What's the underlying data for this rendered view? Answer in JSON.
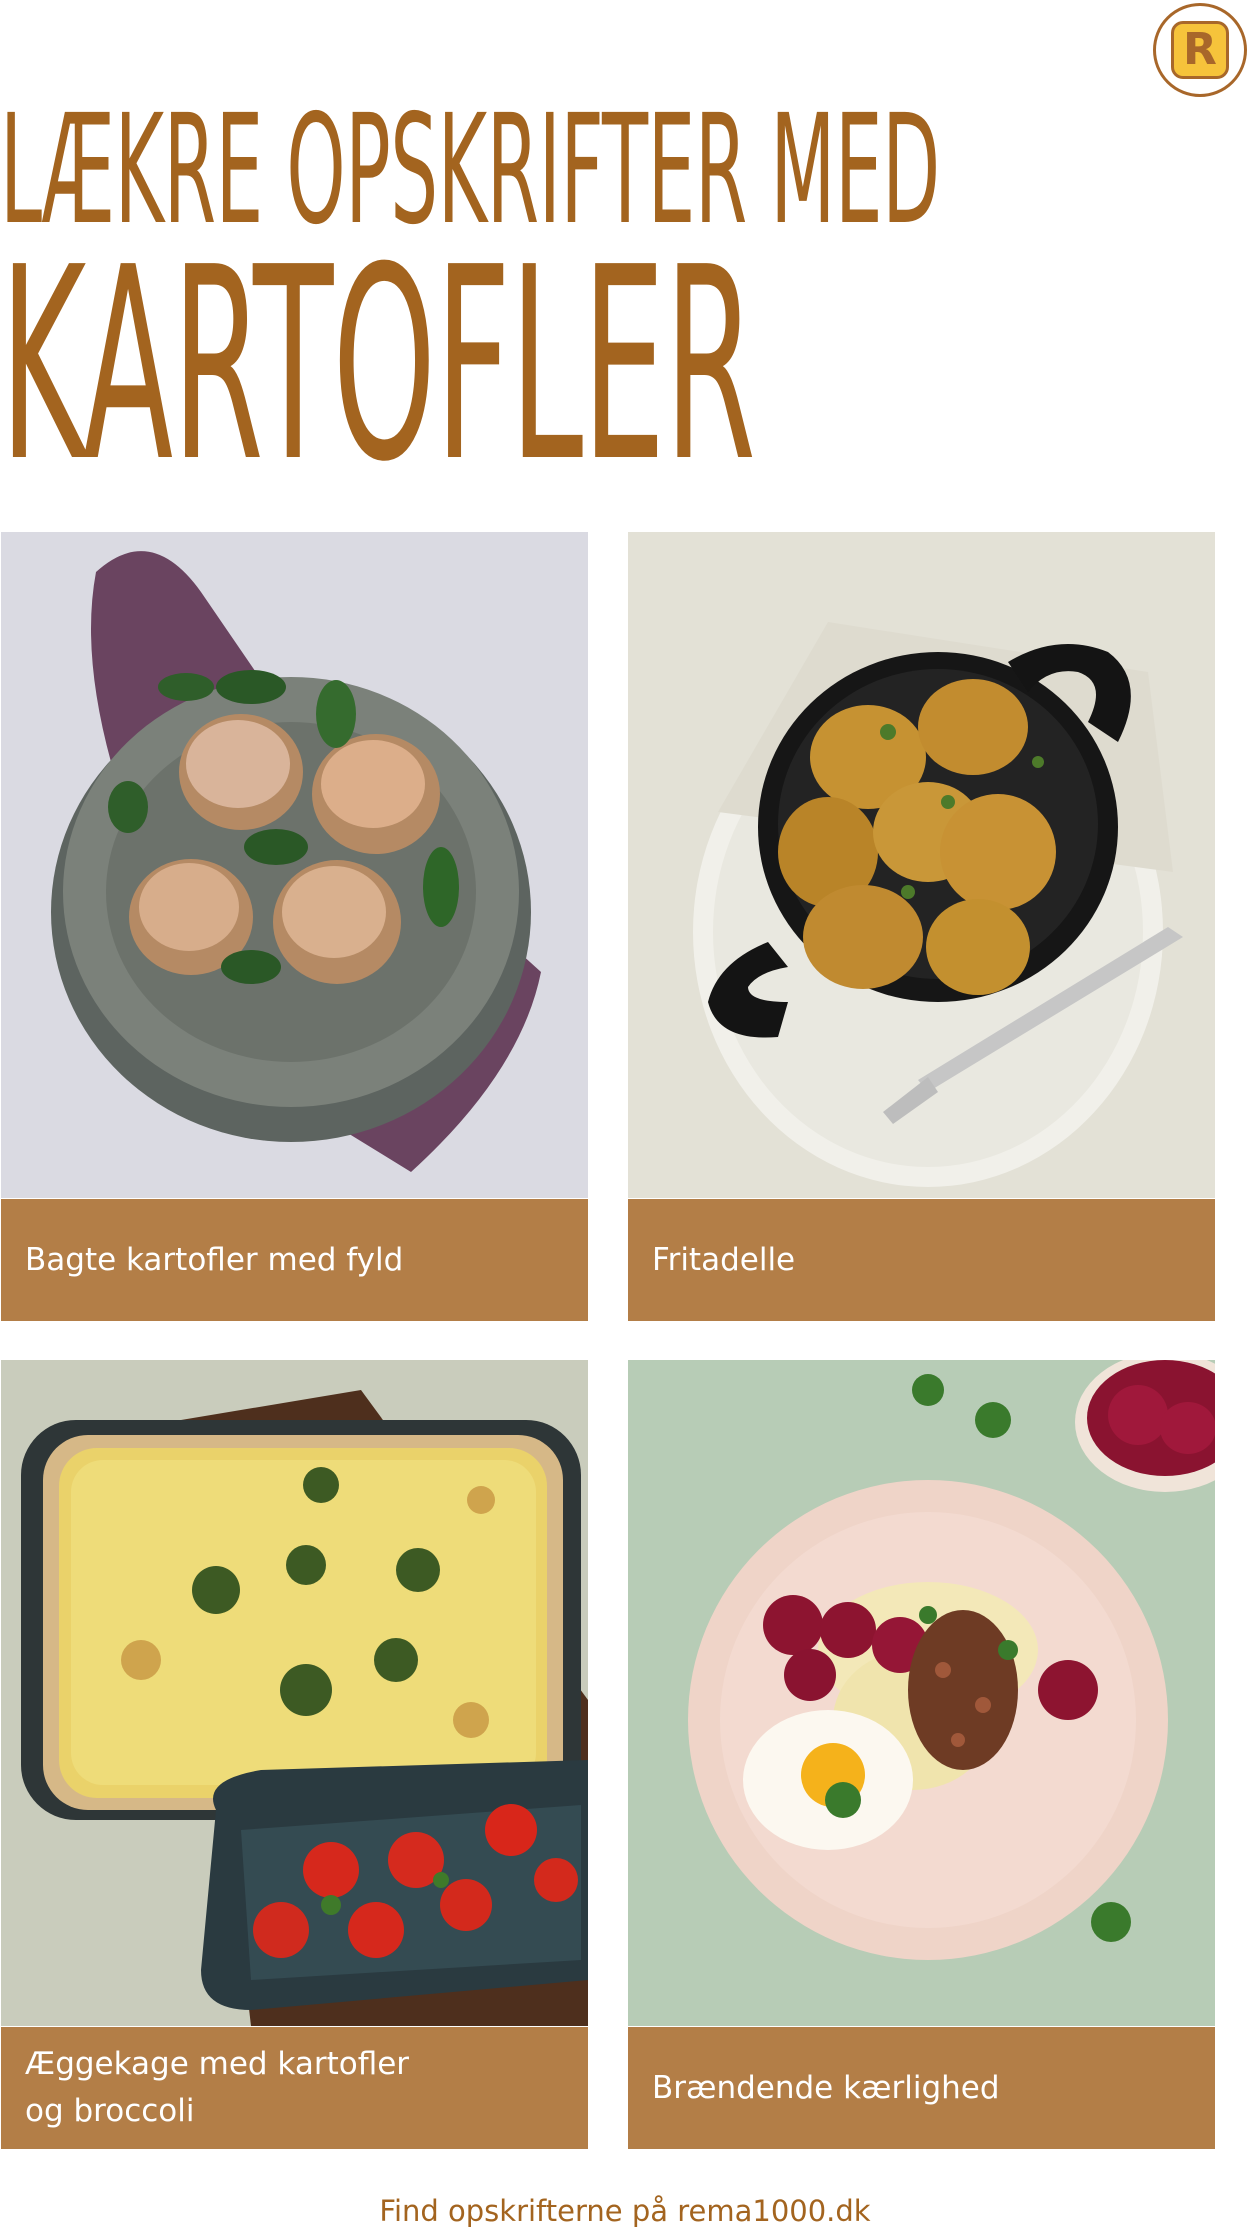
{
  "brand": {
    "logo_letter": "R"
  },
  "headline": {
    "line1": "LÆKRE OPSKRIFTER MED",
    "line2": "KARTOFLER"
  },
  "recipes": [
    {
      "title": "Bagte kartofler med fyld"
    },
    {
      "title": "Fritadelle"
    },
    {
      "title": "Æggekage med kartofler\nog broccoli"
    },
    {
      "title": "Brændende kærlighed"
    }
  ],
  "footer": {
    "text": "Find opskrifterne på rema1000.dk"
  },
  "colors": {
    "brand_brown": "#a3641f",
    "label_bg": "#b37e47",
    "logo_yellow": "#f6c33b"
  }
}
